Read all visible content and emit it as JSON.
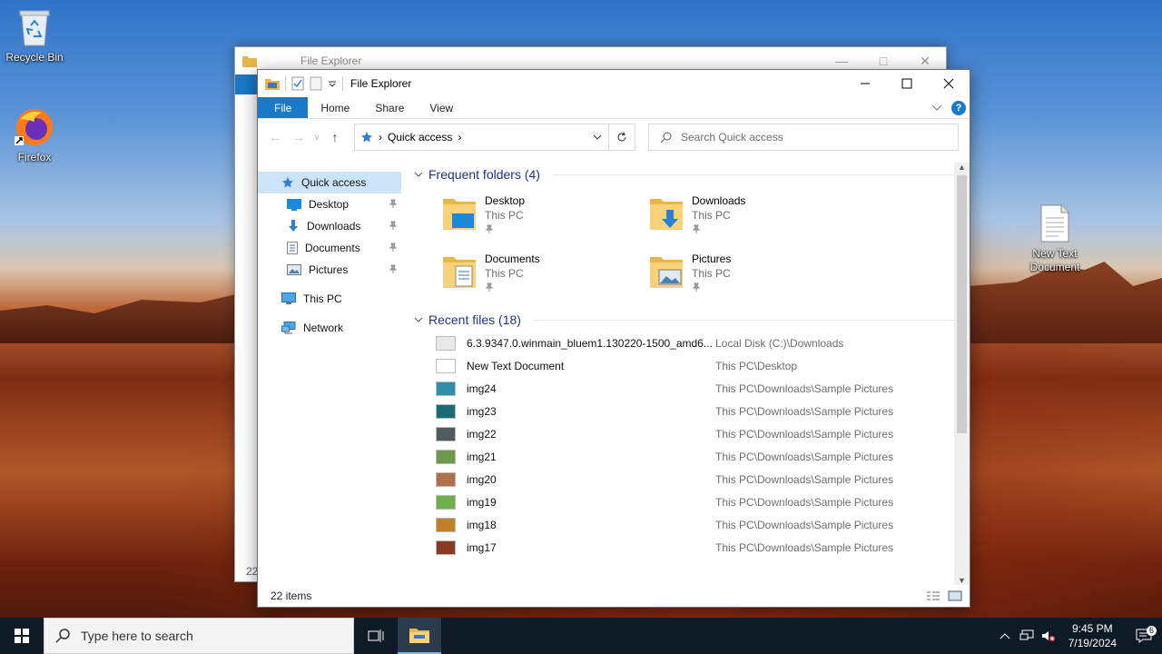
{
  "desktop": {
    "icons": [
      {
        "label": "Recycle Bin"
      },
      {
        "label": "Firefox"
      },
      {
        "label": "New Text Document"
      }
    ]
  },
  "back_window": {
    "title": "File Explorer",
    "status_text": "22"
  },
  "window": {
    "title": "File Explorer",
    "ribbon_tabs": {
      "file": "File",
      "home": "Home",
      "share": "Share",
      "view": "View"
    },
    "help_label": "?",
    "address": {
      "location": "Quick access"
    },
    "search": {
      "placeholder": "Search Quick access"
    },
    "nav_pane": {
      "quick_access": "Quick access",
      "desktop": "Desktop",
      "downloads": "Downloads",
      "documents": "Documents",
      "pictures": "Pictures",
      "this_pc": "This PC",
      "network": "Network"
    },
    "frequent_folders": {
      "heading": "Frequent folders (4)",
      "items": [
        {
          "name": "Desktop",
          "location": "This PC"
        },
        {
          "name": "Downloads",
          "location": "This PC"
        },
        {
          "name": "Documents",
          "location": "This PC"
        },
        {
          "name": "Pictures",
          "location": "This PC"
        }
      ]
    },
    "recent_files": {
      "heading": "Recent files (18)",
      "items": [
        {
          "name": "6.3.9347.0.winmain_bluem1.130220-1500_amd6...",
          "location": "Local Disk (C:)\\Downloads",
          "thumb_color": "#e8e8e8"
        },
        {
          "name": "New Text Document",
          "location": "This PC\\Desktop",
          "thumb_color": "#ffffff"
        },
        {
          "name": "img24",
          "location": "This PC\\Downloads\\Sample Pictures",
          "thumb_color": "#2f8fa8"
        },
        {
          "name": "img23",
          "location": "This PC\\Downloads\\Sample Pictures",
          "thumb_color": "#1a6a78"
        },
        {
          "name": "img22",
          "location": "This PC\\Downloads\\Sample Pictures",
          "thumb_color": "#4f5b5e"
        },
        {
          "name": "img21",
          "location": "This PC\\Downloads\\Sample Pictures",
          "thumb_color": "#6d9a4a"
        },
        {
          "name": "img20",
          "location": "This PC\\Downloads\\Sample Pictures",
          "thumb_color": "#b0704a"
        },
        {
          "name": "img19",
          "location": "This PC\\Downloads\\Sample Pictures",
          "thumb_color": "#6fae4d"
        },
        {
          "name": "img18",
          "location": "This PC\\Downloads\\Sample Pictures",
          "thumb_color": "#c0802a"
        },
        {
          "name": "img17",
          "location": "This PC\\Downloads\\Sample Pictures",
          "thumb_color": "#8a3a20"
        }
      ]
    },
    "status": {
      "items": "22 items"
    }
  },
  "taskbar": {
    "search_placeholder": "Type here to search",
    "time": "9:45 PM",
    "date": "7/19/2024",
    "notification_count": "6"
  },
  "colors": {
    "accent": "#1979ca",
    "group_heading": "#1e3287",
    "taskbar": "#0f1a27"
  }
}
